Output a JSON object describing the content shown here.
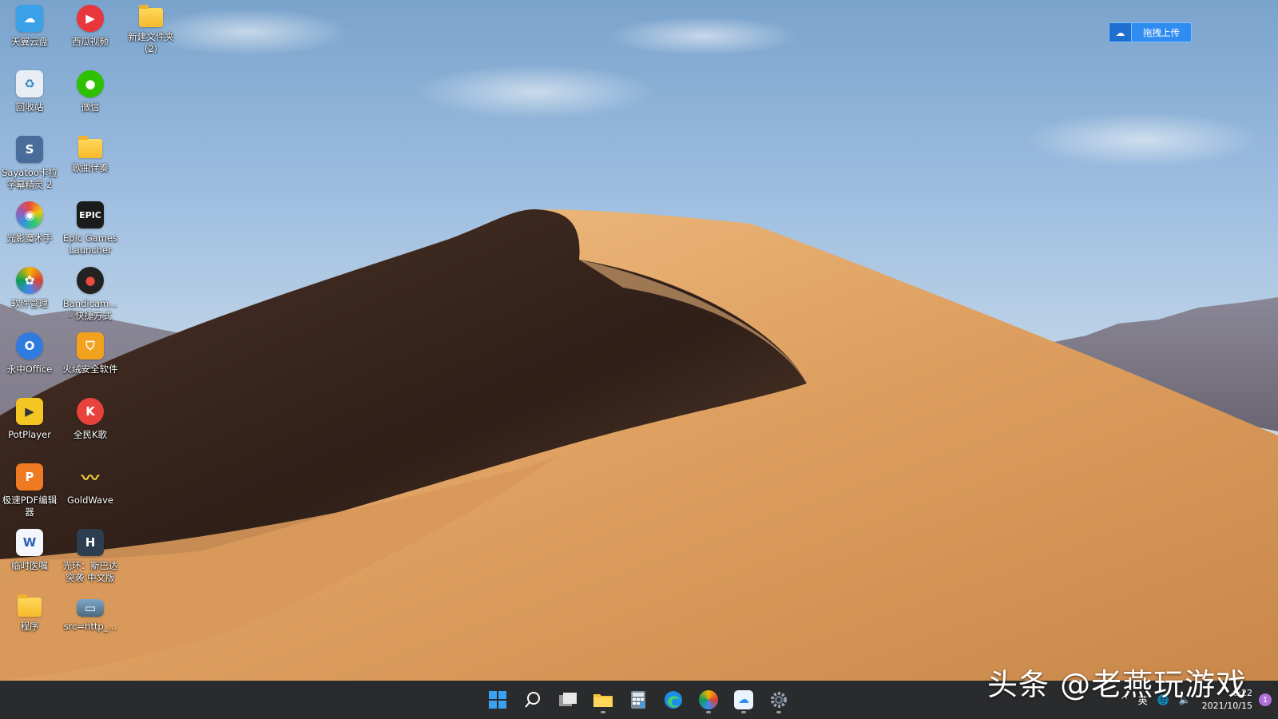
{
  "desktop": {
    "icons": [
      {
        "name": "tianyi-cloud",
        "label": "天翼云盘",
        "icon": "cloud-app-icon",
        "color": "#3aa0e8"
      },
      {
        "name": "xigua-video",
        "label": "西瓜视频",
        "icon": "play-icon",
        "color": "#e8363c"
      },
      {
        "name": "new-folder",
        "label": "新建文件夹 (2)",
        "icon": "folder-icon",
        "color": "#f6b92b"
      },
      {
        "name": "recycle-bin",
        "label": "回收站",
        "icon": "recycle-bin-icon",
        "color": "#dfe8f0"
      },
      {
        "name": "wechat",
        "label": "微信",
        "icon": "wechat-icon",
        "color": "#2dc100"
      },
      {
        "name": "sayatoo",
        "label": "Sayatoo卡拉字幕精灵 2",
        "icon": "sayatoo-icon",
        "color": "#4a6c9a"
      },
      {
        "name": "song-folder",
        "label": "歌曲伴奏",
        "icon": "folder-icon",
        "color": "#f6b92b"
      },
      {
        "name": "guangying",
        "label": "光影魔术手",
        "icon": "aperture-icon",
        "color": "#3a3a3a"
      },
      {
        "name": "epic-games",
        "label": "Epic Games Launcher",
        "icon": "epic-games-icon",
        "color": "#1b1b1b"
      },
      {
        "name": "software-manager",
        "label": "软件管理",
        "icon": "pinwheel-icon",
        "color": "#45b6e8"
      },
      {
        "name": "bandicam",
        "label": "Bandicam... - 快捷方式",
        "icon": "record-icon",
        "color": "#222222"
      },
      {
        "name": "yozo-office",
        "label": "永中Office",
        "icon": "office-icon",
        "color": "#2f7be0"
      },
      {
        "name": "huorong",
        "label": "火绒安全软件",
        "icon": "shield-icon",
        "color": "#f2a21c"
      },
      {
        "name": "potplayer",
        "label": "PotPlayer",
        "icon": "potplayer-icon",
        "color": "#f3c623"
      },
      {
        "name": "quanmin-k",
        "label": "全民K歌",
        "icon": "k-song-icon",
        "color": "#e9423d"
      },
      {
        "name": "jisu-pdf",
        "label": "极速PDF编辑器",
        "icon": "pdf-icon",
        "color": "#f07a22"
      },
      {
        "name": "goldwave",
        "label": "GoldWave",
        "icon": "waveform-icon",
        "color": "#1a1a1a"
      },
      {
        "name": "temp-doc",
        "label": "临时医嘱",
        "icon": "word-doc-icon",
        "color": "#2b5fb8"
      },
      {
        "name": "halo-spartan",
        "label": "光环：斯巴达突袭 中文版",
        "icon": "halo-icon",
        "color": "#2c3e50"
      },
      {
        "name": "program-folder",
        "label": "程序",
        "icon": "folder-icon",
        "color": "#f6b92b"
      },
      {
        "name": "src-image",
        "label": "src=http_...",
        "icon": "image-file-icon",
        "color": "#4d6a7e"
      }
    ],
    "upload_button": {
      "label": "拖拽上传"
    },
    "watermark": "头条 @老燕玩游戏"
  },
  "taskbar": {
    "pinned": [
      {
        "name": "start-button",
        "icon": "windows-logo-icon"
      },
      {
        "name": "search-button",
        "icon": "search-icon"
      },
      {
        "name": "task-view-button",
        "icon": "task-view-icon"
      },
      {
        "name": "file-explorer-button",
        "icon": "folder-icon"
      },
      {
        "name": "calculator-button",
        "icon": "calculator-icon"
      },
      {
        "name": "edge-button",
        "icon": "edge-icon"
      },
      {
        "name": "software-manager-button",
        "icon": "pinwheel-icon"
      },
      {
        "name": "tianyi-cloud-button",
        "icon": "cloud-app-icon"
      },
      {
        "name": "settings-button",
        "icon": "gear-icon"
      }
    ],
    "tray": {
      "chevron": "^",
      "ime": "英",
      "time": "6:22",
      "date": "2021/10/15",
      "notifications": "1"
    }
  }
}
